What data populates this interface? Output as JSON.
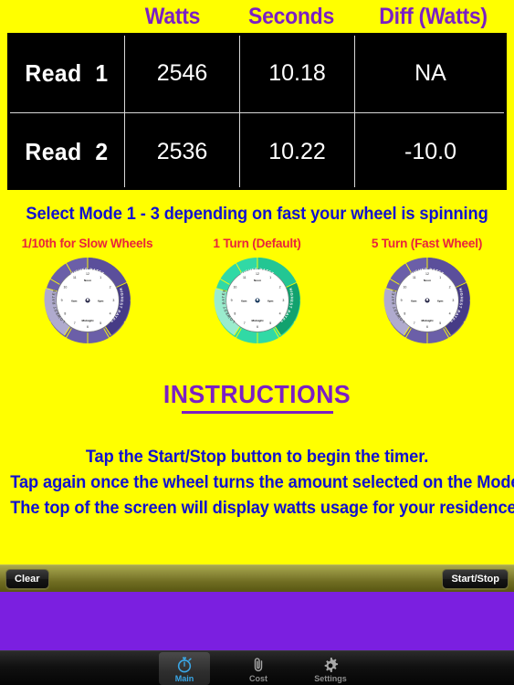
{
  "theme": {
    "background": "#FFFF00",
    "accent_purple": "#7B1FC4",
    "accent_blue": "#1010D0",
    "accent_red": "#E8243C",
    "panel_purple": "#7B1FE0",
    "table_background": "#000000",
    "tab_selected": "#3AA8E8"
  },
  "readings_table": {
    "columns": [
      "",
      "Watts",
      "Seconds",
      "Diff (Watts)"
    ],
    "rows": [
      {
        "label": "Read  1",
        "watts": "2546",
        "seconds": "10.18",
        "diff": "NA"
      },
      {
        "label": "Read  2",
        "watts": "2536",
        "seconds": "10.22",
        "diff": "-10.0"
      }
    ]
  },
  "mode": {
    "prompt": "Select Mode 1 - 3 depending on fast your wheel is spinning",
    "options": [
      {
        "label": "1/10th for Slow Wheels",
        "selected": false
      },
      {
        "label": "1 Turn (Default)",
        "selected": true
      },
      {
        "label": "5 Turn (Fast Wheel)",
        "selected": false
      }
    ],
    "dial": {
      "ring_labels": [
        "HIGHER RATES",
        "HIGHEST RATES",
        "LOWEST RATES"
      ],
      "clock_labels": [
        "Noon",
        "6pm",
        "Midnight",
        "6am"
      ],
      "hour_numbers": [
        "12",
        "1",
        "2",
        "3",
        "4",
        "5",
        "6",
        "7",
        "8",
        "9",
        "10",
        "11"
      ]
    }
  },
  "instructions": {
    "title": "INSTRUCTIONS",
    "lines": [
      "Tap the Start/Stop button to begin the timer.",
      "Tap again once the wheel turns the amount selected on the Mode.",
      "The top of the screen will display watts usage for your residence."
    ]
  },
  "toolbar": {
    "clear_label": "Clear",
    "start_stop_label": "Start/Stop"
  },
  "tabbar": {
    "tabs": [
      {
        "label": "Main",
        "icon": "stopwatch-icon",
        "selected": true
      },
      {
        "label": "Cost",
        "icon": "paperclip-icon",
        "selected": false
      },
      {
        "label": "Settings",
        "icon": "gear-icon",
        "selected": false
      }
    ]
  }
}
